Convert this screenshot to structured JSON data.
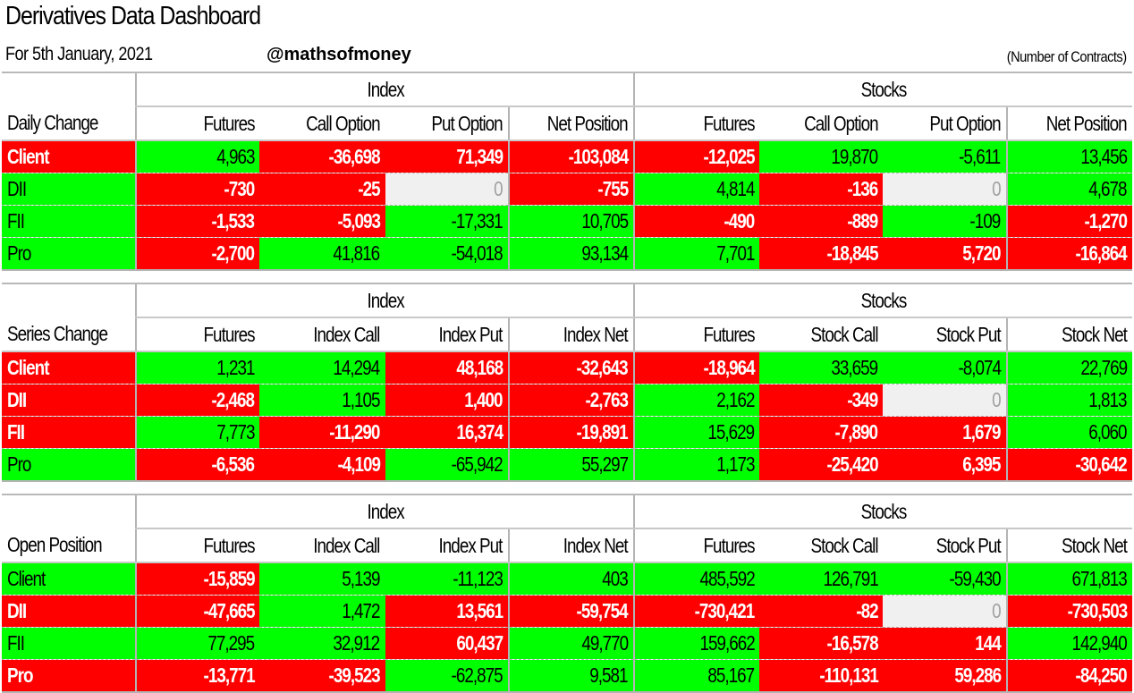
{
  "header": {
    "title": "Derivatives Data Dashboard",
    "subtitle": "For 5th January, 2021",
    "handle": "@mathsofmoney",
    "units": "(Number of Contracts)"
  },
  "colors": {
    "positive": "#00ff00",
    "negative": "#ff0000",
    "zero": "#f0f0f0"
  },
  "tables": [
    {
      "name": "Daily Change",
      "groups": [
        "Index",
        "Stocks"
      ],
      "columns": [
        "Futures",
        "Call Option",
        "Put Option",
        "Net Position",
        "Futures",
        "Call Option",
        "Put Option",
        "Net Position"
      ],
      "rows": [
        {
          "label": "Client",
          "label_sign": "neg",
          "values": [
            "4,963",
            "-36,698",
            "71,349",
            "-103,084",
            "-12,025",
            "19,870",
            "-5,611",
            "13,456"
          ],
          "signs": [
            "pos",
            "neg",
            "neg",
            "neg",
            "neg",
            "pos",
            "pos",
            "pos"
          ]
        },
        {
          "label": "DII",
          "label_sign": "pos",
          "values": [
            "-730",
            "-25",
            "0",
            "-755",
            "4,814",
            "-136",
            "0",
            "4,678"
          ],
          "signs": [
            "neg",
            "neg",
            "zero",
            "neg",
            "pos",
            "neg",
            "zero",
            "pos"
          ]
        },
        {
          "label": "FII",
          "label_sign": "pos",
          "values": [
            "-1,533",
            "-5,093",
            "-17,331",
            "10,705",
            "-490",
            "-889",
            "-109",
            "-1,270"
          ],
          "signs": [
            "neg",
            "neg",
            "pos",
            "pos",
            "neg",
            "neg",
            "pos",
            "neg"
          ]
        },
        {
          "label": "Pro",
          "label_sign": "pos",
          "values": [
            "-2,700",
            "41,816",
            "-54,018",
            "93,134",
            "7,701",
            "-18,845",
            "5,720",
            "-16,864"
          ],
          "signs": [
            "neg",
            "pos",
            "pos",
            "pos",
            "pos",
            "neg",
            "neg",
            "neg"
          ]
        }
      ]
    },
    {
      "name": "Series Change",
      "groups": [
        "Index",
        "Stocks"
      ],
      "columns": [
        "Futures",
        "Index Call",
        "Index Put",
        "Index Net",
        "Futures",
        "Stock Call",
        "Stock Put",
        "Stock Net"
      ],
      "rows": [
        {
          "label": "Client",
          "label_sign": "neg",
          "values": [
            "1,231",
            "14,294",
            "48,168",
            "-32,643",
            "-18,964",
            "33,659",
            "-8,074",
            "22,769"
          ],
          "signs": [
            "pos",
            "pos",
            "neg",
            "neg",
            "neg",
            "pos",
            "pos",
            "pos"
          ]
        },
        {
          "label": "DII",
          "label_sign": "neg",
          "values": [
            "-2,468",
            "1,105",
            "1,400",
            "-2,763",
            "2,162",
            "-349",
            "0",
            "1,813"
          ],
          "signs": [
            "neg",
            "pos",
            "neg",
            "neg",
            "pos",
            "neg",
            "zero",
            "pos"
          ]
        },
        {
          "label": "FII",
          "label_sign": "neg",
          "values": [
            "7,773",
            "-11,290",
            "16,374",
            "-19,891",
            "15,629",
            "-7,890",
            "1,679",
            "6,060"
          ],
          "signs": [
            "pos",
            "neg",
            "neg",
            "neg",
            "pos",
            "neg",
            "neg",
            "pos"
          ]
        },
        {
          "label": "Pro",
          "label_sign": "pos",
          "values": [
            "-6,536",
            "-4,109",
            "-65,942",
            "55,297",
            "1,173",
            "-25,420",
            "6,395",
            "-30,642"
          ],
          "signs": [
            "neg",
            "neg",
            "pos",
            "pos",
            "pos",
            "neg",
            "neg",
            "neg"
          ]
        }
      ]
    },
    {
      "name": "Open Position",
      "groups": [
        "Index",
        "Stocks"
      ],
      "columns": [
        "Futures",
        "Index Call",
        "Index Put",
        "Index Net",
        "Futures",
        "Stock Call",
        "Stock Put",
        "Stock Net"
      ],
      "rows": [
        {
          "label": "Client",
          "label_sign": "pos",
          "values": [
            "-15,859",
            "5,139",
            "-11,123",
            "403",
            "485,592",
            "126,791",
            "-59,430",
            "671,813"
          ],
          "signs": [
            "neg",
            "pos",
            "pos",
            "pos",
            "pos",
            "pos",
            "pos",
            "pos"
          ]
        },
        {
          "label": "DII",
          "label_sign": "neg",
          "values": [
            "-47,665",
            "1,472",
            "13,561",
            "-59,754",
            "-730,421",
            "-82",
            "0",
            "-730,503"
          ],
          "signs": [
            "neg",
            "pos",
            "neg",
            "neg",
            "neg",
            "neg",
            "zero",
            "neg"
          ]
        },
        {
          "label": "FII",
          "label_sign": "pos",
          "values": [
            "77,295",
            "32,912",
            "60,437",
            "49,770",
            "159,662",
            "-16,578",
            "144",
            "142,940"
          ],
          "signs": [
            "pos",
            "pos",
            "neg",
            "pos",
            "pos",
            "neg",
            "neg",
            "pos"
          ]
        },
        {
          "label": "Pro",
          "label_sign": "neg",
          "values": [
            "-13,771",
            "-39,523",
            "-62,875",
            "9,581",
            "85,167",
            "-110,131",
            "59,286",
            "-84,250"
          ],
          "signs": [
            "neg",
            "neg",
            "pos",
            "pos",
            "pos",
            "neg",
            "neg",
            "neg"
          ]
        }
      ]
    }
  ]
}
